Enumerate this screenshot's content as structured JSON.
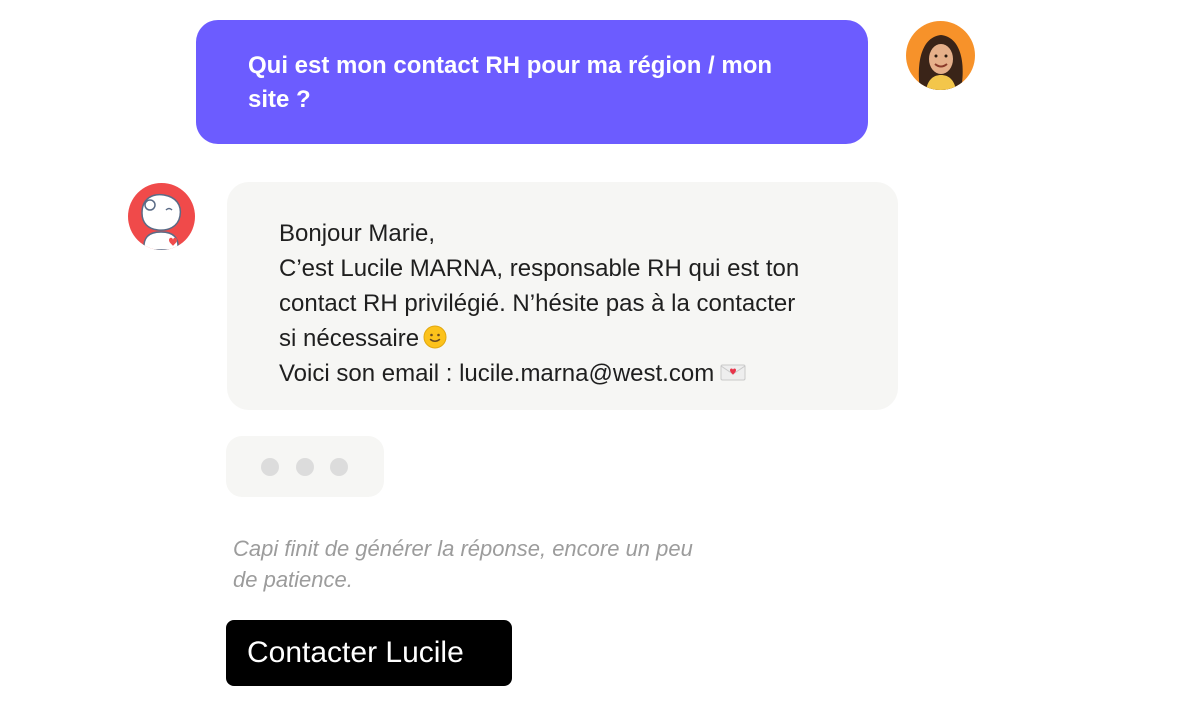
{
  "user_message": {
    "text": "Qui est mon contact RH pour ma région / mon site ?",
    "bubble_color": "#6c5cff",
    "avatar": "user-avatar-photo"
  },
  "bot_message": {
    "avatar": "capi-robot-avatar",
    "avatar_color": "#f04a4a",
    "lines": [
      "Bonjour Marie,",
      "C’est Lucile MARNA, responsable RH qui est ton",
      "contact RH privilégié. N’hésite pas à la contacter",
      "si nécessaire",
      "Voici son email : lucile.marna@west.com"
    ],
    "icons": [
      "slightly-smiling-face-icon",
      "love-letter-icon"
    ]
  },
  "typing_indicator": {
    "dot_count": 3
  },
  "status": {
    "loading_text": "Capi finit de générer la réponse, encore un peu de patience."
  },
  "action": {
    "button_label": "Contacter Lucile",
    "button_color": "#000000"
  }
}
